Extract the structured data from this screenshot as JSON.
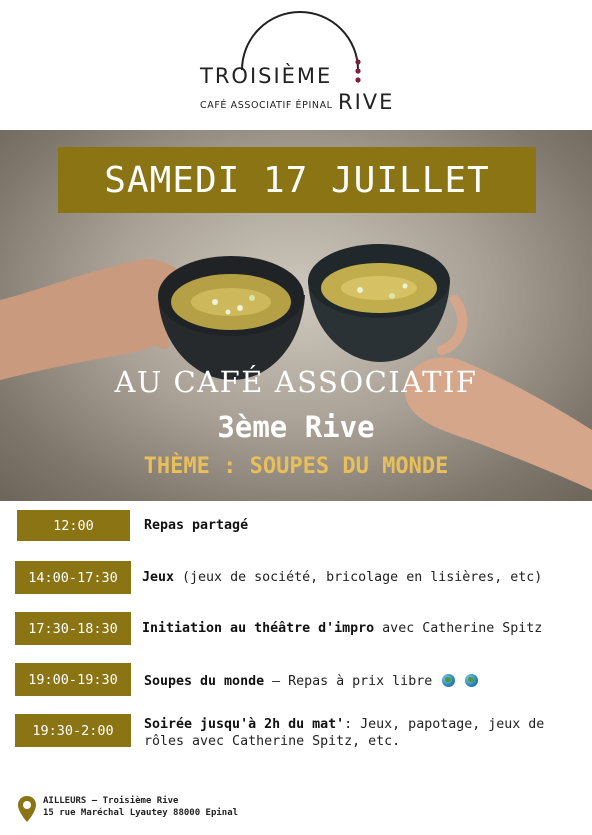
{
  "logo": {
    "name": "TROISIÈME",
    "subtitle": "CAFÉ ASSOCIATIF ÉPINAL",
    "rive": "RIVE"
  },
  "hero": {
    "date": "SAMEDI 17 JUILLET",
    "line1": "AU CAFÉ ASSOCIATIF",
    "line2": "3ème Rive",
    "line3": "THÈME : SOUPES DU MONDE"
  },
  "schedule": [
    {
      "time": "12:00",
      "title": "Repas partagé",
      "rest": ""
    },
    {
      "time": "14:00-17:30",
      "title": "Jeux",
      "rest": " (jeux de société, bricolage en lisières, etc)"
    },
    {
      "time": "17:30-18:30",
      "title": "Initiation au théâtre d'impro",
      "rest": " avec Catherine Spitz"
    },
    {
      "time": "19:00-19:30",
      "title": "Soupes du monde",
      "rest": " – Repas à prix libre "
    },
    {
      "time": "19:30-2:00",
      "title": "Soirée jusqu'à 2h du mat'",
      "rest": ": Jeux, papotage, jeux de rôles avec Catherine Spitz, etc."
    }
  ],
  "footer": {
    "line1": "AILLEURS – Troisième Rive",
    "line2": "15 rue Maréchal Lyautey 88000 Epinal"
  },
  "colors": {
    "accent": "#8a7414",
    "theme_text": "#e8bf5a",
    "logo_dots": "#7a1f3d"
  }
}
